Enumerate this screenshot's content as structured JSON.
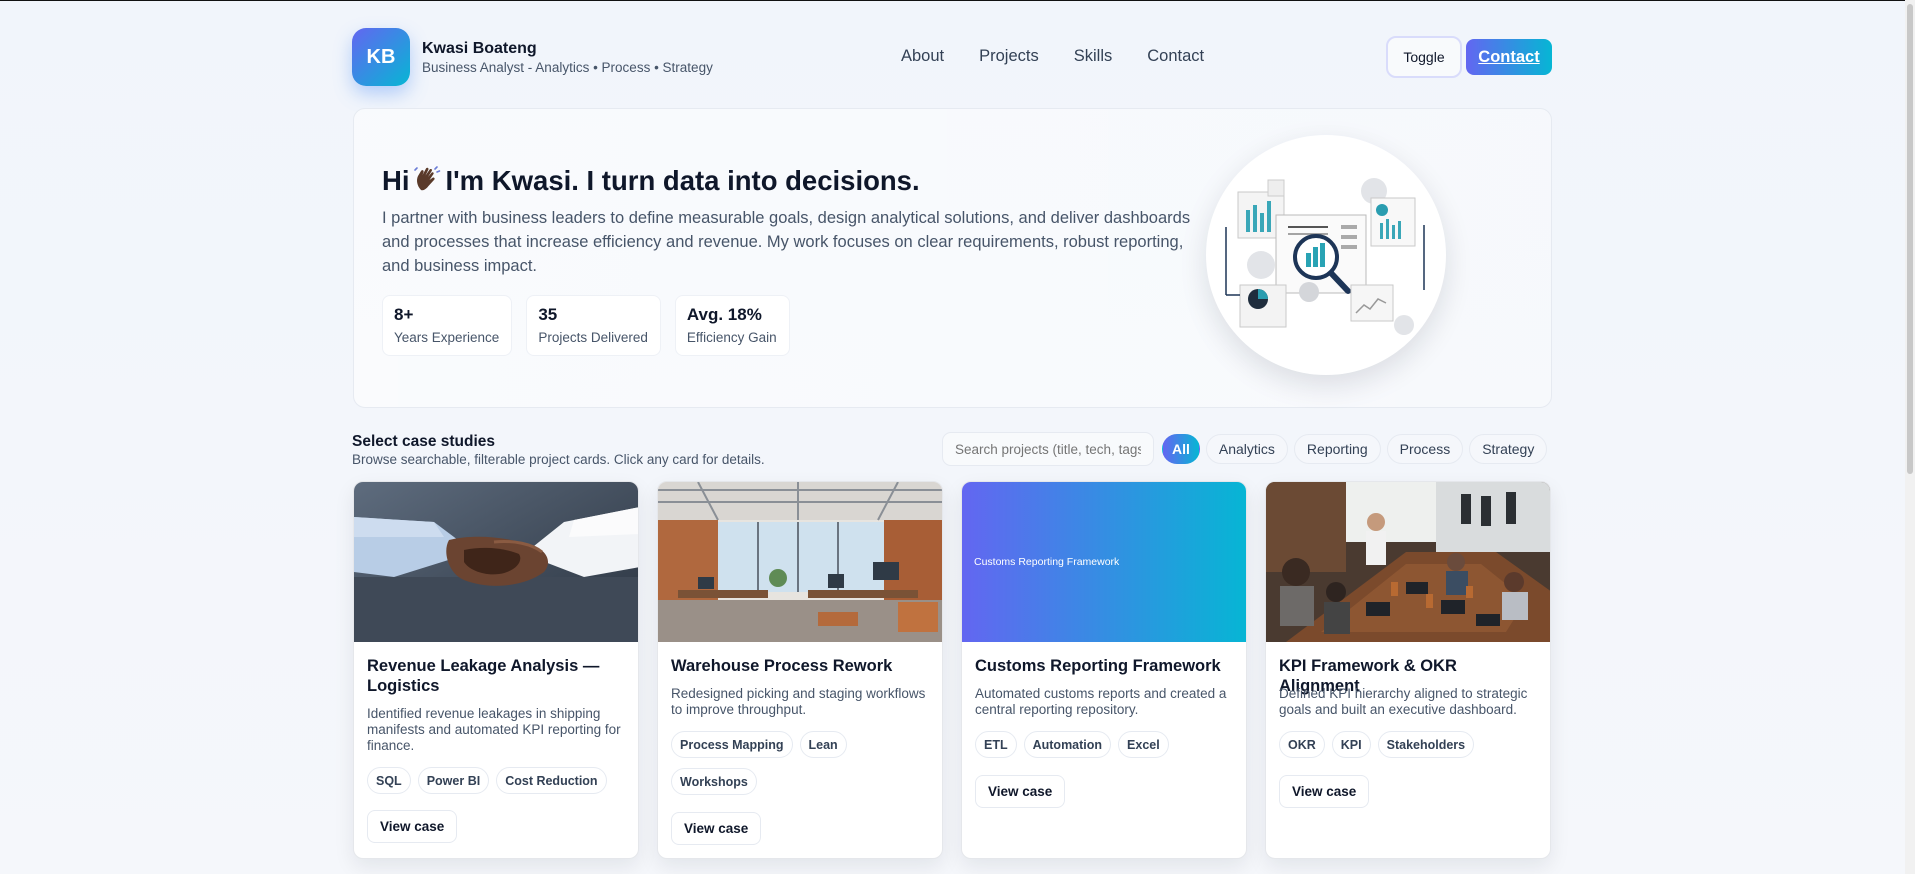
{
  "header": {
    "logo_initials": "KB",
    "name": "Kwasi Boateng",
    "tagline": "Business Analyst - Analytics • Process • Strategy",
    "nav": [
      "About",
      "Projects",
      "Skills",
      "Contact"
    ],
    "toggle_label": "Toggle",
    "contact_label": "Contact"
  },
  "hero": {
    "greeting_before": "Hi",
    "greeting_after": "I'm Kwasi. I turn data into decisions.",
    "wave_icon": "waving-hand-icon",
    "description": "I partner with business leaders to define measurable goals, design analytical solutions, and deliver dashboards and processes that increase efficiency and revenue. My work focuses on clear requirements, robust reporting, and business impact.",
    "stats": [
      {
        "value": "8+",
        "label": "Years Experience"
      },
      {
        "value": "35",
        "label": "Projects Delivered"
      },
      {
        "value": "Avg. 18%",
        "label": "Efficiency Gain"
      }
    ]
  },
  "cases": {
    "title": "Select case studies",
    "subtitle": "Browse searchable, filterable project cards. Click any card for details.",
    "search_placeholder": "Search projects (title, tech, tags)",
    "filters": [
      "All",
      "Analytics",
      "Reporting",
      "Process",
      "Strategy"
    ],
    "active_filter": "All",
    "view_label": "View case",
    "cards": [
      {
        "title": "Revenue Leakage Analysis — Logistics",
        "description": "Identified revenue leakages in shipping manifests and automated KPI reporting for finance.",
        "tags": [
          "SQL",
          "Power BI",
          "Cost Reduction"
        ],
        "image": "handshake-photo"
      },
      {
        "title": "Warehouse Process Rework",
        "description": "Redesigned picking and staging workflows to improve throughput.",
        "tags": [
          "Process Mapping",
          "Lean",
          "Workshops"
        ],
        "image": "office-photo"
      },
      {
        "title": "Customs Reporting Framework",
        "description": "Automated customs reports and created a central reporting repository.",
        "tags": [
          "ETL",
          "Automation",
          "Excel"
        ],
        "image_text": "Customs Reporting Framework"
      },
      {
        "title": "KPI Framework & OKR Alignment",
        "description": "Defined KPI hierarchy aligned to strategic goals and built an executive dashboard.",
        "tags": [
          "OKR",
          "KPI",
          "Stakeholders"
        ],
        "image": "meeting-photo"
      }
    ]
  },
  "colors": {
    "accent_start": "#6366f1",
    "accent_end": "#06b6d4",
    "text": "#0f172a",
    "muted": "#475569"
  }
}
